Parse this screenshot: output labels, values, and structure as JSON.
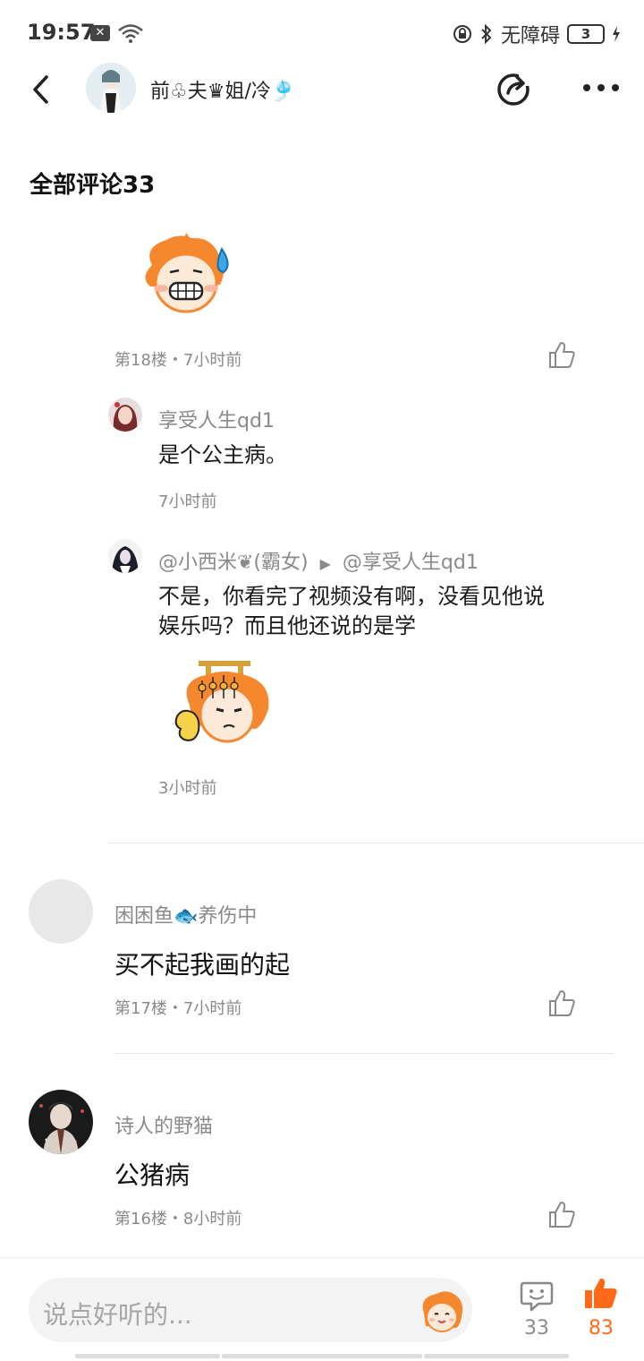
{
  "status_bar": {
    "time": "19:57",
    "notification_badge": "✕",
    "accessibility_label": "无障碍",
    "battery_level": "3"
  },
  "header": {
    "title": "前♧夫♛姐/冷🎐"
  },
  "section": {
    "title": "全部评论33"
  },
  "comments": [
    {
      "floor_meta": "第18楼・7小时前",
      "has_sticker": true,
      "replies": [
        {
          "name": "享受人生qd1",
          "text": "是个公主病。",
          "time": "7小时前"
        },
        {
          "name": "@小西米❦(霸女)",
          "arrow": "▶",
          "reply_to": "@享受人生qd1",
          "text_line1": "不是，你看完了视频没有啊，没看见他说",
          "text_line2": "娱乐吗？而且他还说的是学",
          "time": "3小时前"
        }
      ]
    },
    {
      "name": "困困鱼🐟养伤中",
      "text": "买不起我画的起",
      "meta": "第17楼・7小时前"
    },
    {
      "name": "诗人的野猫",
      "text": "公猪病",
      "meta": "第16楼・8小时前"
    }
  ],
  "bottom_bar": {
    "input_placeholder": "说点好听的...",
    "comment_count": "33",
    "like_count": "83"
  },
  "colors": {
    "accent": "#ff6a1a",
    "muted_text": "#8a8a8a",
    "input_bg": "#f3f3f3"
  },
  "icons": [
    "back-arrow-icon",
    "share-icon",
    "more-icon",
    "like-icon",
    "emoji-icon",
    "comment-icon",
    "thumbs-up-filled-icon"
  ]
}
